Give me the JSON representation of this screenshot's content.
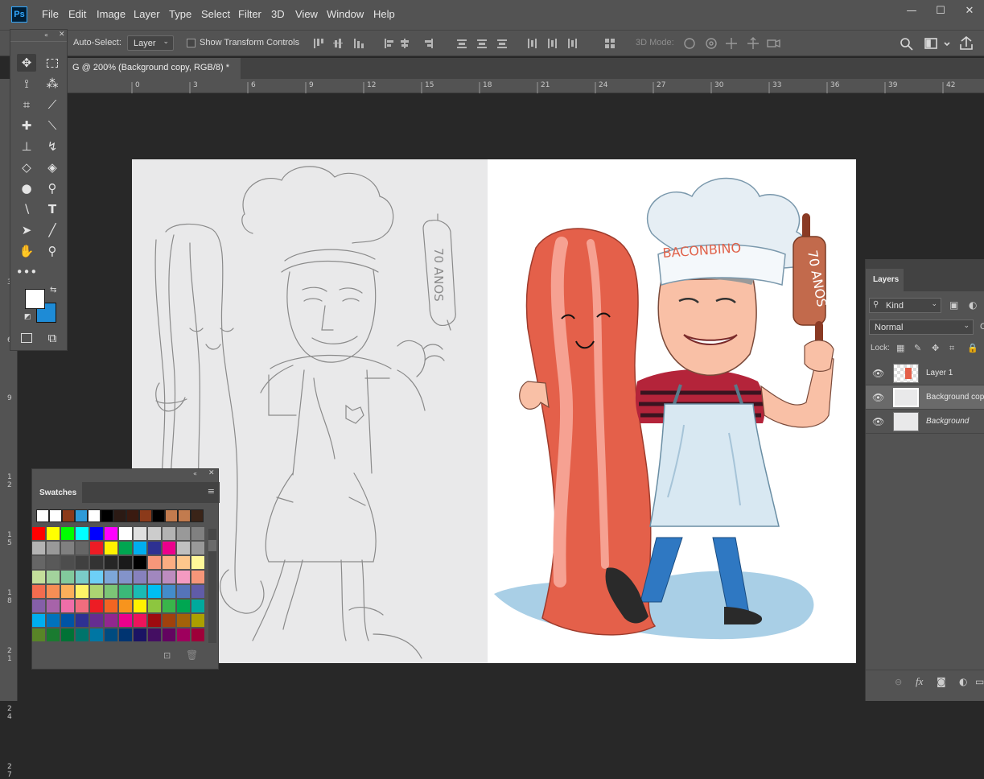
{
  "app": {
    "logo": "Ps"
  },
  "menu": [
    "File",
    "Edit",
    "Image",
    "Layer",
    "Type",
    "Select",
    "Filter",
    "3D",
    "View",
    "Window",
    "Help"
  ],
  "window_controls": {
    "minimize": "—",
    "restore": "☐",
    "close": "✕"
  },
  "options_bar": {
    "auto_select_label": "Auto-Select:",
    "auto_select_value": "Layer",
    "transform_label": "Show Transform Controls",
    "mode_3d_label": "3D Mode:"
  },
  "document": {
    "tab_title": "G @ 200% (Background copy, RGB/8) *"
  },
  "rulers": {
    "h_ticks": [
      "0",
      "3",
      "6",
      "9",
      "12",
      "15",
      "18",
      "21",
      "24",
      "27",
      "30",
      "33",
      "36",
      "39",
      "42"
    ],
    "v_ticks": [
      "3",
      "6",
      "9",
      "1\n2",
      "1\n5",
      "1\n8",
      "2\n1",
      "2\n4",
      "2\n7"
    ]
  },
  "art": {
    "chef_hat_text": "BACONBINO",
    "rolling_pin_text": "70 ANOS",
    "sketch_pin_text": "70 ANOS"
  },
  "swatches_panel": {
    "title": "Swatches",
    "recent": [
      "#ffffff",
      "#ffffff",
      "#8b3a1a",
      "#2e9ad7",
      "#ffffff",
      "#000000",
      "#2b1a14",
      "#3a1a10",
      "#8b3a1a",
      "#000000",
      "#c27b4e",
      "#c27b4e",
      "#3a2418"
    ],
    "grid": [
      [
        "#ff0000",
        "#ffff00",
        "#00ff00",
        "#00ffff",
        "#0000ff",
        "#ff00ff",
        "#ffffff",
        "#e0e0e0",
        "#cccccc",
        "#b3b3b3",
        "#999999",
        "#808080"
      ],
      [
        "#b3b3b3",
        "#999999",
        "#808080",
        "#666666",
        "#ed1c24",
        "#fff200",
        "#00a651",
        "#00aeef",
        "#2e3192",
        "#ec008c",
        "#c0c0c0",
        "#999999"
      ],
      [
        "#666666",
        "#595959",
        "#4d4d4d",
        "#404040",
        "#333333",
        "#262626",
        "#1a1a1a",
        "#000000",
        "#f7977a",
        "#fbad82",
        "#fdc68c",
        "#fff799"
      ],
      [
        "#c4df9b",
        "#a3d39c",
        "#82ca9c",
        "#7accc8",
        "#6dcff6",
        "#7da7d8",
        "#8393ca",
        "#8781bd",
        "#a187be",
        "#bd8cbf",
        "#f49ac1",
        "#f69679"
      ],
      [
        "#f26c4f",
        "#f68e55",
        "#fbaf5a",
        "#fff467",
        "#acd372",
        "#7cc576",
        "#3bb878",
        "#1abbb4",
        "#00bff3",
        "#438ccb",
        "#5574b9",
        "#605ca8"
      ],
      [
        "#855fa8",
        "#a763a9",
        "#ef6ea8",
        "#f16d7e",
        "#ed1c24",
        "#f26522",
        "#f7941d",
        "#fff200",
        "#8dc63f",
        "#39b54a",
        "#00a651",
        "#00a99d"
      ],
      [
        "#00aeef",
        "#0072bc",
        "#0054a5",
        "#2e3192",
        "#662d91",
        "#92278f",
        "#ec008c",
        "#ed145b",
        "#9e0b0f",
        "#a0410d",
        "#a36209",
        "#aba000"
      ],
      [
        "#598527",
        "#1a7b30",
        "#007236",
        "#00746b",
        "#0076a3",
        "#004b80",
        "#003471",
        "#1b1464",
        "#440e62",
        "#630460",
        "#9e005d",
        "#9e0039"
      ]
    ]
  },
  "layers_panel": {
    "title": "Layers",
    "filter_label": "Kind",
    "blend_mode": "Normal",
    "lock_label": "Lock:",
    "layers": [
      {
        "name": "Layer 1",
        "italic": false,
        "selected": false
      },
      {
        "name": "Background copy",
        "italic": false,
        "selected": true
      },
      {
        "name": "Background",
        "italic": true,
        "selected": false
      }
    ]
  },
  "colors": {
    "foreground": "#ffffff",
    "background": "#1e8bd6",
    "bacon_dark": "#e4604a",
    "bacon_light": "#f6a192",
    "shirt_red": "#b4243a",
    "apron": "#d8e8f2",
    "jeans": "#2f78c2",
    "hat": "#e6eef4",
    "pin": "#c26a4c",
    "shadow": "#a9cfe6"
  }
}
